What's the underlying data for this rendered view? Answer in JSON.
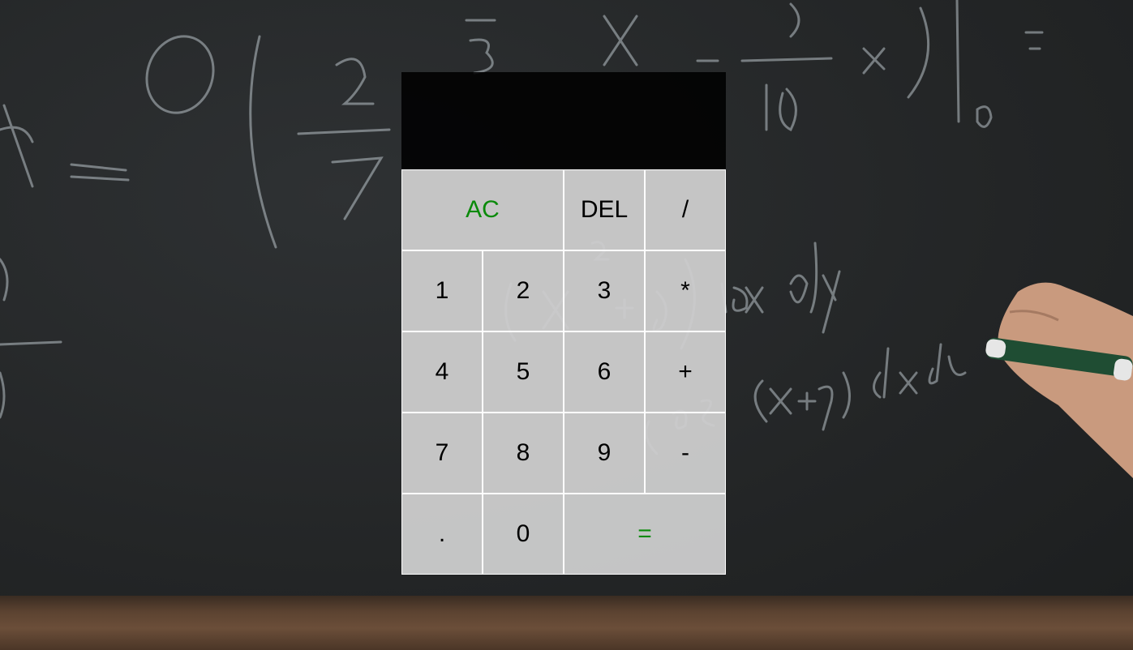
{
  "display": {
    "previous_operand": "",
    "current_operand": ""
  },
  "buttons": {
    "all_clear": "AC",
    "delete": "DEL",
    "divide": "/",
    "one": "1",
    "two": "2",
    "three": "3",
    "multiply": "*",
    "four": "4",
    "five": "5",
    "six": "6",
    "add": "+",
    "seven": "7",
    "eight": "8",
    "nine": "9",
    "subtract": "-",
    "decimal": ".",
    "zero": "0",
    "equals": "="
  },
  "colors": {
    "accent": "#0a8a0a",
    "button_background": "#cdcdcd",
    "display_background": "#000000"
  }
}
